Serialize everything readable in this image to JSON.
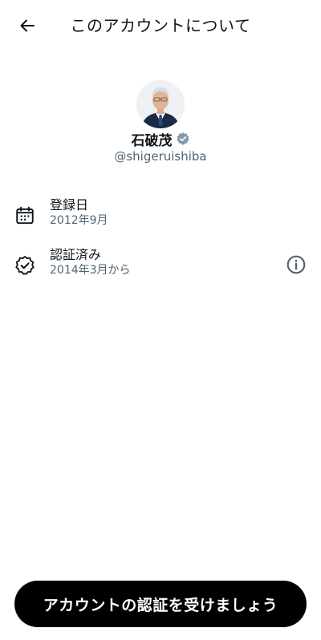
{
  "header": {
    "title": "このアカウントについて",
    "back_icon": "arrow-left-icon"
  },
  "profile": {
    "name": "石破茂",
    "handle": "@shigeruishiba",
    "verified": true,
    "verified_color": "#829aab"
  },
  "rows": [
    {
      "icon": "calendar-icon",
      "label": "登録日",
      "value": "2012年9月"
    },
    {
      "icon": "verified-badge-icon",
      "label": "認証済み",
      "value": "2014年3月から",
      "action_icon": "info-icon"
    }
  ],
  "cta": {
    "label": "アカウントの認証を受けましょう"
  },
  "colors": {
    "text_primary": "#0f1419",
    "text_secondary": "#536471",
    "button_bg": "#000000",
    "button_text": "#ffffff"
  }
}
